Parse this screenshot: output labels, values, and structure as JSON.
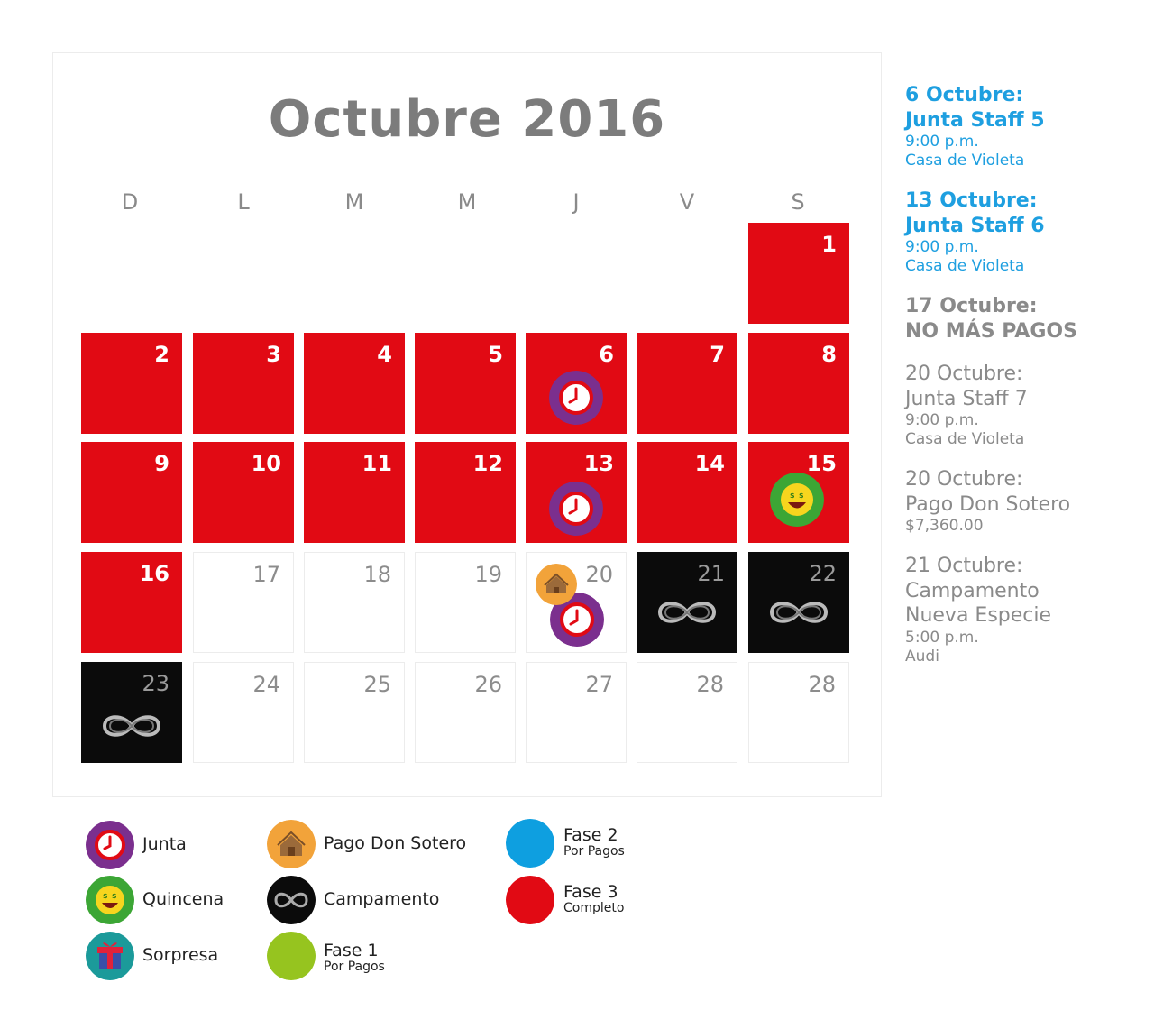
{
  "title": "Octubre 2016",
  "weekdays": [
    "D",
    "L",
    "M",
    "M",
    "J",
    "V",
    "S"
  ],
  "days": [
    "1",
    "2",
    "3",
    "4",
    "5",
    "6",
    "7",
    "8",
    "9",
    "10",
    "11",
    "12",
    "13",
    "14",
    "15",
    "16",
    "17",
    "18",
    "19",
    "20",
    "21",
    "22",
    "23",
    "24",
    "25",
    "26",
    "27",
    "28",
    "28"
  ],
  "colors": {
    "red": "#e10a14",
    "black": "#0b0b0b",
    "blue_text": "#1e9fe0",
    "gray_text": "#8a8a8a",
    "junta": "#7b2f8e",
    "quincena": "#3ca635",
    "sorpresa": "#1b9a9a",
    "pago": "#f2a33a",
    "fase1": "#96c41f",
    "fase2": "#0e9fe0",
    "fase3": "#e10a14"
  },
  "icons": {
    "junta": "clock-icon",
    "quincena": "money-face-icon",
    "sorpresa": "gift-icon",
    "pago": "house-icon",
    "campamento": "infinity-icon"
  },
  "events": [
    {
      "title": "6 Octubre:",
      "name": "Junta Staff 5",
      "time": "9:00 p.m.",
      "place": "Casa de Violeta"
    },
    {
      "title": "13 Octubre:",
      "name": "Junta Staff 6",
      "time": "9:00 p.m.",
      "place": "Casa de Violeta"
    },
    {
      "title": "17 Octubre:",
      "name": "NO MÁS PAGOS"
    },
    {
      "title": "20 Octubre:",
      "name": "Junta Staff 7",
      "time": "9:00 p.m.",
      "place": "Casa de Violeta"
    },
    {
      "title": "20 Octubre:",
      "name": "Pago Don Sotero",
      "amount": "$7,360.00"
    },
    {
      "title": "21 Octubre:",
      "name": "Campamento",
      "name2": "Nueva Especie",
      "time": "5:00 p.m.",
      "place": "Audi"
    }
  ],
  "legend": {
    "junta": "Junta",
    "quincena": "Quincena",
    "sorpresa": "Sorpresa",
    "pago": "Pago Don Sotero",
    "campamento": "Campamento",
    "fase1": "Fase 1",
    "fase1_sub": "Por Pagos",
    "fase2": "Fase 2",
    "fase2_sub": "Por Pagos",
    "fase3": "Fase 3",
    "fase3_sub": "Completo"
  }
}
